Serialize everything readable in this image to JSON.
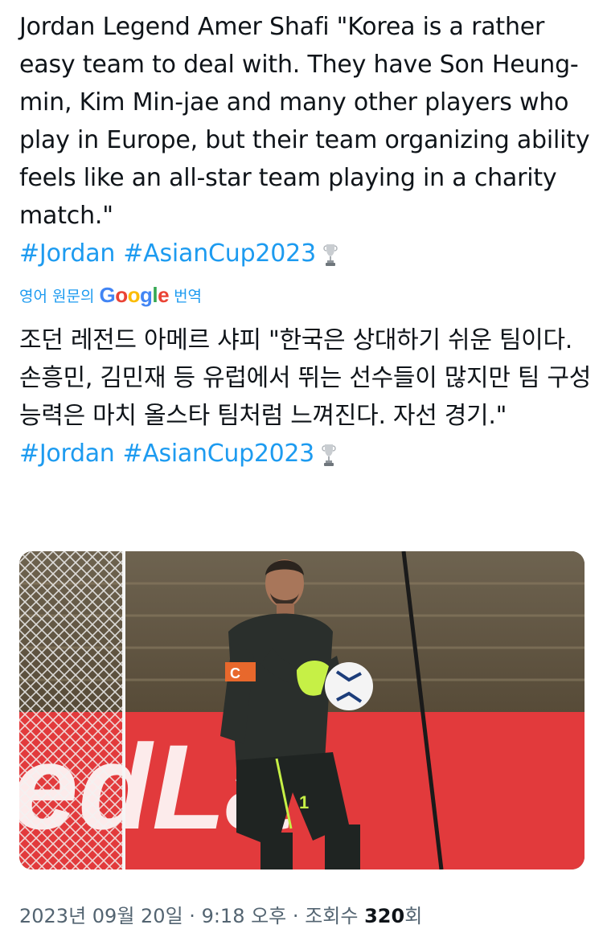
{
  "tweet": {
    "text": "Jordan Legend Amer Shafi \"Korea is a rather easy team to deal with. They have Son Heung-min, Kim Min-jae and many other players who play in Europe, but their team organizing ability feels like an all-star team playing in a charity match.\"",
    "hashtags": [
      "#Jordan",
      "#AsianCup2023"
    ],
    "hashtag_icon": "trophy-icon"
  },
  "translation_bar": {
    "prefix": "영어 원문의",
    "brand": "Google",
    "suffix": "번역",
    "brand_colors": [
      "#4285F4",
      "#EA4335",
      "#FBBC05",
      "#4285F4",
      "#34A853",
      "#EA4335"
    ]
  },
  "translation": {
    "text": "조던 레전드 아메르 샤피 \"한국은 상대하기 쉬운 팀이다. 손흥민, 김민재 등 유럽에서 뛰는 선수들이 많지만 팀 구성 능력은 마치 올스타 팀처럼 느껴진다. 자선 경기.\"",
    "hashtags": [
      "#Jordan",
      "#AsianCup2023"
    ]
  },
  "media": {
    "banner_text": "edLa",
    "kit_number": "1",
    "armband_letter": "C"
  },
  "meta": {
    "date": "2023년 09월 20일",
    "sep1": "·",
    "time": "9:18 오후",
    "sep2": "·",
    "views_label": "조회수",
    "views_count": "320",
    "views_suffix": "회"
  },
  "colors": {
    "link": "#1d9bf0",
    "text": "#0f1419",
    "muted": "#536471"
  }
}
